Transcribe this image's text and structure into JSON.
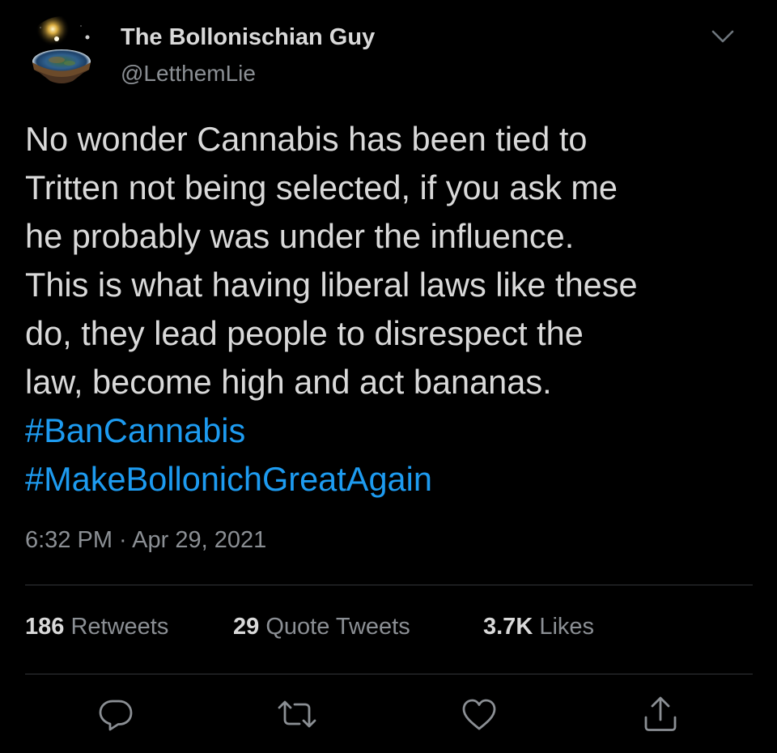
{
  "author": {
    "display_name": "The Bollonischian Guy",
    "handle": "@LetthemLie"
  },
  "tweet": {
    "lines": [
      "No wonder Cannabis has been tied to",
      "Tritten not being selected, if you ask me",
      "he probably was under the influence.",
      "This is what having liberal laws like these",
      "do, they lead people to disrespect the",
      "law, become high and act bananas."
    ],
    "hashtags": [
      "#BanCannabis",
      "#MakeBollonichGreatAgain"
    ],
    "timestamp": "6:32 PM · Apr 29, 2021"
  },
  "stats": {
    "retweets_count": "186",
    "retweets_label": "Retweets",
    "quotes_count": "29",
    "quotes_label": "Quote Tweets",
    "likes_count": "3.7K",
    "likes_label": "Likes"
  },
  "icons": {
    "chevron": "chevron-down-icon",
    "reply": "reply-icon",
    "retweet": "retweet-icon",
    "like": "heart-icon",
    "share": "share-icon"
  },
  "colors": {
    "background": "#000000",
    "text": "#d9d9d9",
    "secondary": "#8b8f94",
    "link": "#1d9bf0",
    "divider": "#333639"
  }
}
